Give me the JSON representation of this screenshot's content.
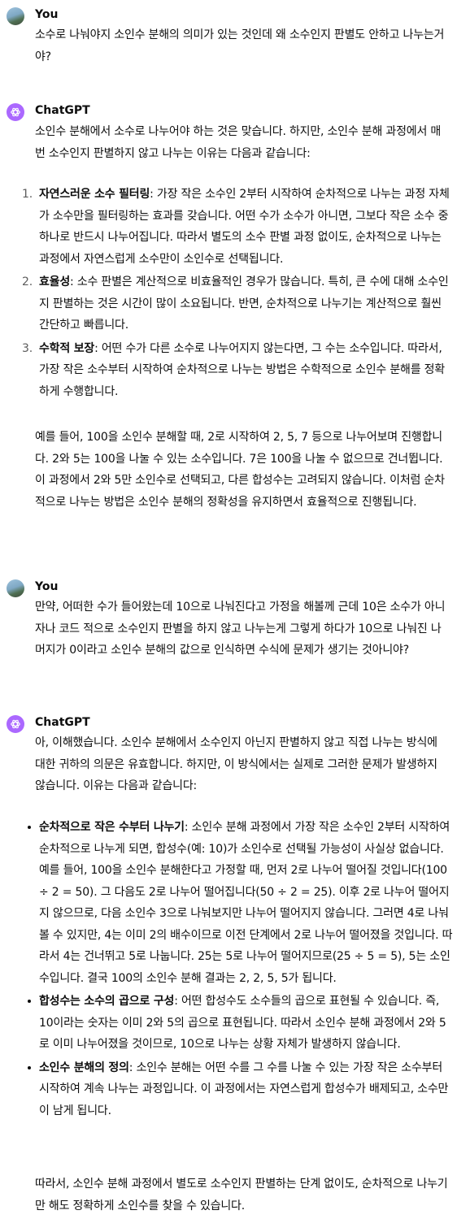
{
  "messages": [
    {
      "author": "You",
      "text": "소수로 나눠야지 소인수 분해의 의미가 있는 것인데 왜 소수인지 판별도 안하고 나누는거야?"
    },
    {
      "author": "ChatGPT",
      "intro": "소인수 분해에서 소수로 나누어야 하는 것은 맞습니다. 하지만, 소인수 분해 과정에서 매번 소수인지 판별하지 않고 나누는 이유는 다음과 같습니다:",
      "items": [
        {
          "num": "1.",
          "title": "자연스러운 소수 필터링",
          "body": ": 가장 작은 소수인 2부터 시작하여 순차적으로 나누는 과정 자체가 소수만을 필터링하는 효과를 갖습니다. 어떤 수가 소수가 아니면, 그보다 작은 소수 중 하나로 반드시 나누어집니다. 따라서 별도의 소수 판별 과정 없이도, 순차적으로 나누는 과정에서 자연스럽게 소수만이 소인수로 선택됩니다."
        },
        {
          "num": "2.",
          "title": "효율성",
          "body": ": 소수 판별은 계산적으로 비효율적인 경우가 많습니다. 특히, 큰 수에 대해 소수인지 판별하는 것은 시간이 많이 소요됩니다. 반면, 순차적으로 나누기는 계산적으로 훨씬 간단하고 빠릅니다."
        },
        {
          "num": "3.",
          "title": "수학적 보장",
          "body": ": 어떤 수가 다른 소수로 나누어지지 않는다면, 그 수는 소수입니다. 따라서, 가장 작은 소수부터 시작하여 순차적으로 나누는 방법은 수학적으로 소인수 분해를 정확하게 수행합니다."
        }
      ],
      "outro": "예를 들어, 100을 소인수 분해할 때, 2로 시작하여 2, 5, 7 등으로 나누어보며 진행합니다. 2와 5는 100을 나눌 수 있는 소수입니다. 7은 100을 나눌 수 없으므로 건너뜁니다. 이 과정에서 2와 5만 소인수로 선택되고, 다른 합성수는 고려되지 않습니다. 이처럼 순차적으로 나누는 방법은 소인수 분해의 정확성을 유지하면서 효율적으로 진행됩니다."
    },
    {
      "author": "You",
      "text": "만약, 어떠한 수가 들어왔는데 10으로 나눠진다고 가정을 해볼께 근데 10은 소수가 아니자나 코드 적으로 소수인지 판별을 하지 않고 나누는게 그렇게 하다가 10으로 나눠진 나머지가 0이라고 소인수 분해의 값으로 인식하면 수식에 문제가 생기는 것아니야?"
    },
    {
      "author": "ChatGPT",
      "intro": "아, 이해했습니다. 소인수 분해에서 소수인지 아닌지 판별하지 않고 직접 나누는 방식에 대한 귀하의 의문은 유효합니다. 하지만, 이 방식에서는 실제로 그러한 문제가 발생하지 않습니다. 이유는 다음과 같습니다:",
      "items": [
        {
          "title": "순차적으로 작은 수부터 나누기",
          "body": ": 소인수 분해 과정에서 가장 작은 소수인 2부터 시작하여 순차적으로 나누게 되면, 합성수(예: 10)가 소인수로 선택될 가능성이 사실상 없습니다. 예를 들어, 100을 소인수 분해한다고 가정할 때, 먼저 2로 나누어 떨어질 것입니다(100 ÷ 2 = 50). 그 다음도 2로 나누어 떨어집니다(50 ÷ 2 = 25). 이후 2로 나누어 떨어지지 않으므로, 다음 소인수 3으로 나눠보지만 나누어 떨어지지 않습니다. 그러면 4로 나눠볼 수 있지만, 4는 이미 2의 배수이므로 이전 단계에서 2로 나누어 떨어졌을 것입니다. 따라서 4는 건너뛰고 5로 나눕니다. 25는 5로 나누어 떨어지므로(25 ÷ 5 = 5), 5는 소인수입니다. 결국 100의 소인수 분해 결과는 2, 2, 5, 5가 됩니다."
        },
        {
          "title": "합성수는 소수의 곱으로 구성",
          "body": ": 어떤 합성수도 소수들의 곱으로 표현될 수 있습니다. 즉, 10이라는 숫자는 이미 2와 5의 곱으로 표현됩니다. 따라서 소인수 분해 과정에서 2와 5로 이미 나누어졌을 것이므로, 10으로 나누는 상황 자체가 발생하지 않습니다."
        },
        {
          "title": "소인수 분해의 정의",
          "body": ": 소인수 분해는 어떤 수를 그 수를 나눌 수 있는 가장 작은 소수부터 시작하여 계속 나누는 과정입니다. 이 과정에서는 자연스럽게 합성수가 배제되고, 소수만이 남게 됩니다."
        }
      ],
      "outro": "따라서, 소인수 분해 과정에서 별도로 소수인지 판별하는 단계 없이도, 순차적으로 나누기만 해도 정확하게 소인수를 찾을 수 있습니다."
    }
  ]
}
